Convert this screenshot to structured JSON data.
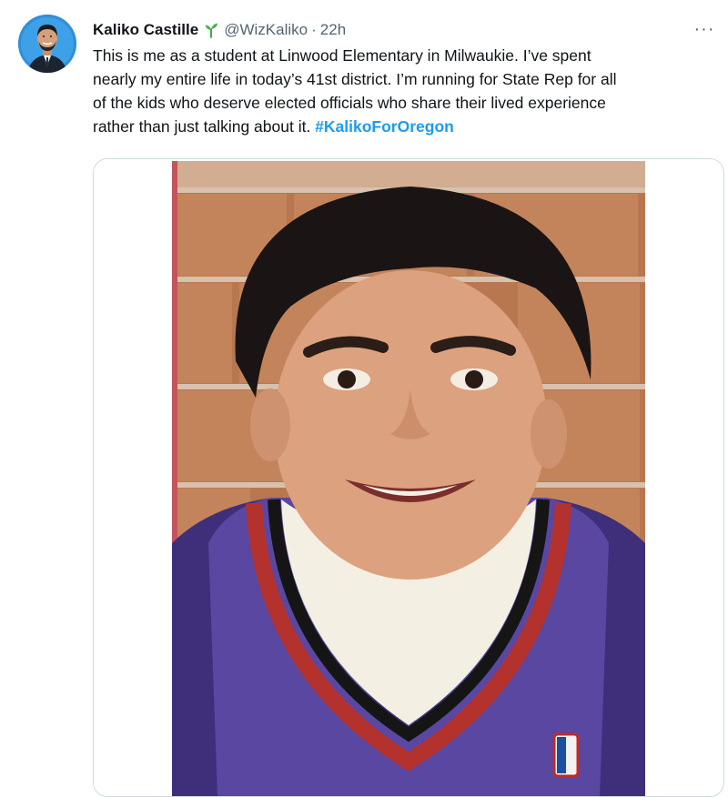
{
  "tweet": {
    "author": {
      "display_name": "Kaliko Castille",
      "handle": "@WizKaliko",
      "badge_icon": "sprout-icon"
    },
    "separator": "·",
    "time": "22h",
    "more_label": "···",
    "text_lines": [
      "This is me as a student at Linwood Elementary in Milwaukie. I’ve spent",
      "nearly my entire life in today’s 41st district. I’m running for State Rep for all",
      "of the kids who deserve elected officials who share their lived experience",
      "rather than just talking about it. "
    ],
    "hashtag": "#KalikoForOregon",
    "colors": {
      "link": "#1d9bf0",
      "secondary_text": "#536471",
      "border": "#cfd9de"
    }
  }
}
